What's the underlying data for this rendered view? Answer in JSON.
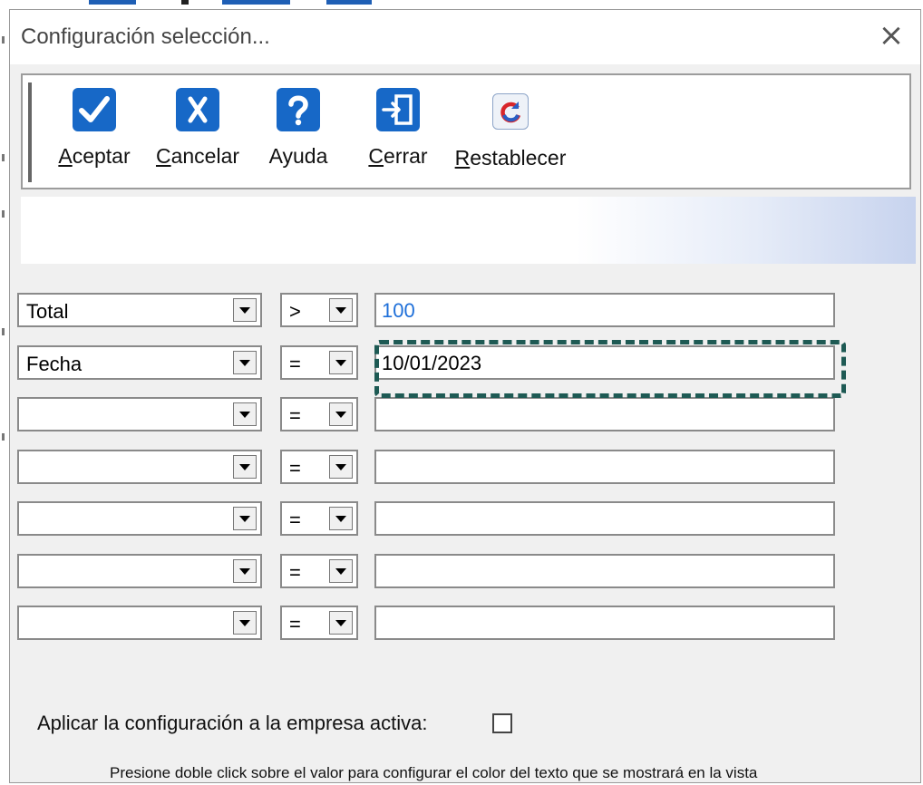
{
  "window": {
    "title": "Configuración selección...",
    "close_glyph": "×"
  },
  "toolbar": {
    "buttons": [
      {
        "access_key": "A",
        "rest": "ceptar",
        "icon": "checkmark-icon"
      },
      {
        "access_key": "C",
        "rest": "ancelar",
        "icon": "x-icon"
      },
      {
        "access_key": "",
        "rest": "Ayuda",
        "icon": "question-icon"
      },
      {
        "access_key": "C",
        "rest": "errar",
        "icon": "door-exit-icon"
      },
      {
        "access_key": "R",
        "rest": "establecer",
        "icon": "refresh-icon"
      }
    ]
  },
  "criteria": [
    {
      "field": "Total",
      "operator": ">",
      "value": "100",
      "value_color": "#1e6fd9"
    },
    {
      "field": "Fecha",
      "operator": "=",
      "value": "10/01/2023",
      "value_color": "#000000"
    },
    {
      "field": "",
      "operator": "=",
      "value": ""
    },
    {
      "field": "",
      "operator": "=",
      "value": ""
    },
    {
      "field": "",
      "operator": "=",
      "value": ""
    },
    {
      "field": "",
      "operator": "=",
      "value": ""
    },
    {
      "field": "",
      "operator": "=",
      "value": ""
    }
  ],
  "apply": {
    "label": "Aplicar la configuración a la empresa activa:",
    "checked": false
  },
  "footer": {
    "hint": "Presione doble click sobre el valor para configurar el color del texto que se mostrará en la vista"
  },
  "colors": {
    "accent": "#1768c7",
    "highlight_border": "#1e5a54"
  }
}
